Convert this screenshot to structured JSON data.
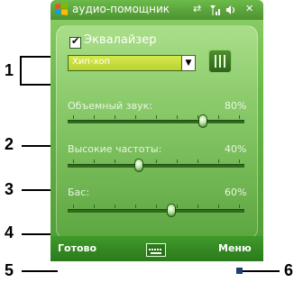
{
  "window": {
    "title": "аудио-помощник",
    "status": {
      "connectivity_icon": "sync-arrows-icon",
      "signal_icon": "signal-antenna-icon",
      "volume_icon": "speaker-volume-icon",
      "close_glyph": "✕"
    }
  },
  "equalizer": {
    "label": "Эквалайзер",
    "checked": true,
    "preset_value": "Хип-хоп",
    "settings_icon": "equalizer-sliders-icon"
  },
  "sliders": [
    {
      "label": "Объемный звук:",
      "value_text": "80%",
      "position": 0.8
    },
    {
      "label": "Высокие частоты:",
      "value_text": "40%",
      "position": 0.4
    },
    {
      "label": "Бас:",
      "value_text": "60%",
      "position": 0.6
    }
  ],
  "softkeys": {
    "left": "Готово",
    "right": "Меню",
    "center_icon": "keyboard-icon"
  },
  "callouts": {
    "n1": "1",
    "n2": "2",
    "n3": "3",
    "n4": "4",
    "n5": "5",
    "n6": "6"
  },
  "colors": {
    "accent_green": "#4c9a35",
    "slider_track": "#2f6a1d",
    "preset_field": "#c8dd3c"
  }
}
